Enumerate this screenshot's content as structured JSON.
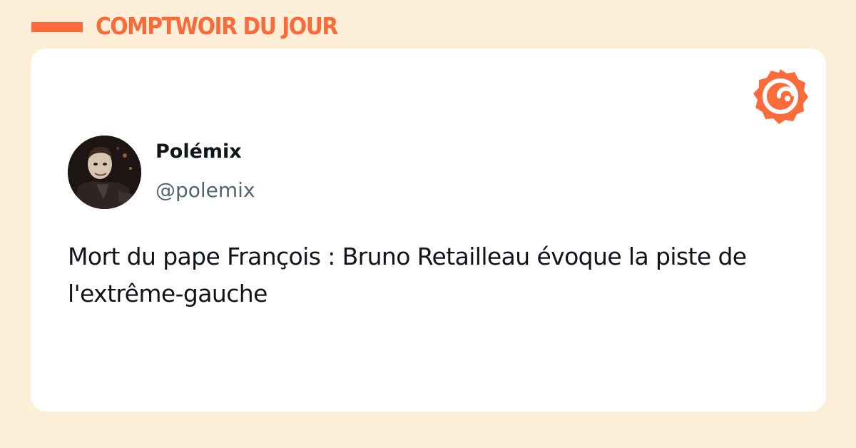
{
  "header": {
    "title": "COMPTWOIR DU JOUR"
  },
  "card": {
    "brand_icon": "orange-badge-eye-icon",
    "author": {
      "name": "Polémix",
      "handle": "@polemix",
      "avatar_icon": "puppet-avatar"
    },
    "text": "Mort du pape François : Bruno Retailleau évoque la piste de l'extrême-gauche"
  },
  "colors": {
    "background": "#fdeed8",
    "accent": "#fb6b3a",
    "card": "#ffffff",
    "text": "#0f1419",
    "muted": "#536471"
  }
}
